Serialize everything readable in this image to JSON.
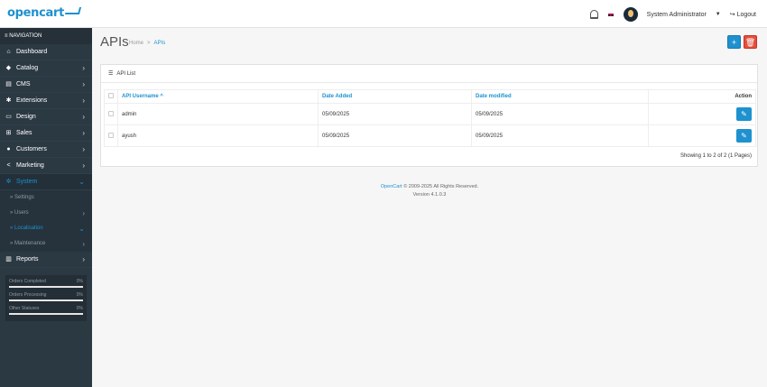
{
  "header": {
    "logo": "opencart",
    "user_name": "System Administrator",
    "logout_label": "Logout"
  },
  "sidebar": {
    "nav_title": "NAVIGATION",
    "items": [
      {
        "label": "Dashboard",
        "icon": "home-icon",
        "arrow": false
      },
      {
        "label": "Catalog",
        "icon": "tag-icon",
        "arrow": true
      },
      {
        "label": "CMS",
        "icon": "newspaper-icon",
        "arrow": true
      },
      {
        "label": "Extensions",
        "icon": "puzzle-icon",
        "arrow": true
      },
      {
        "label": "Design",
        "icon": "monitor-icon",
        "arrow": true
      },
      {
        "label": "Sales",
        "icon": "cart-icon",
        "arrow": true
      },
      {
        "label": "Customers",
        "icon": "user-icon",
        "arrow": true
      },
      {
        "label": "Marketing",
        "icon": "share-icon",
        "arrow": true
      },
      {
        "label": "System",
        "icon": "cog-icon",
        "arrow": true
      }
    ],
    "sub_items": [
      {
        "label": "Settings"
      },
      {
        "label": "Users"
      },
      {
        "label": "Localisation"
      },
      {
        "label": "Maintenance"
      }
    ],
    "reports_label": "Reports",
    "stats": [
      {
        "label": "Orders Completed",
        "value": "0%"
      },
      {
        "label": "Orders Processing",
        "value": "0%"
      },
      {
        "label": "Other Statuses",
        "value": "0%"
      }
    ]
  },
  "page": {
    "title": "APIs",
    "breadcrumb_home": "Home",
    "breadcrumb_current": "APIs"
  },
  "panel": {
    "title": "API List",
    "columns": [
      "API Username ^",
      "Date Added",
      "Date modified",
      "Action"
    ],
    "rows": [
      {
        "username": "admin",
        "date_added": "05/09/2025",
        "date_modified": "05/09/2025"
      },
      {
        "username": "ayush",
        "date_added": "05/09/2025",
        "date_modified": "05/09/2025"
      }
    ],
    "showing": "Showing 1 to 2 of 2 (1 Pages)"
  },
  "footer": {
    "brand": "OpenCart",
    "copyright": " © 2009-2025 All Rights Reserved.",
    "version": "Version 4.1.0.3"
  },
  "colors": {
    "accent": "#1e91cf",
    "danger": "#e3503e",
    "sidebar": "#2b3943"
  }
}
